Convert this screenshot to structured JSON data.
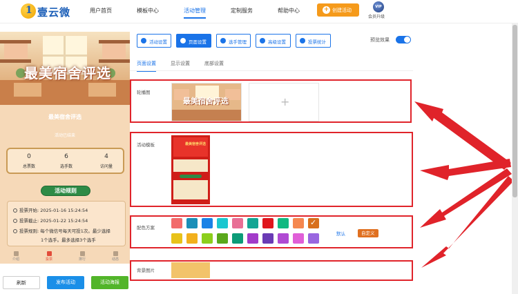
{
  "header": {
    "logo_text": "壹云微",
    "nav": [
      "用户首页",
      "模板中心",
      "活动管理",
      "定制服务",
      "帮助中心"
    ],
    "active_nav": 2,
    "create_label": "创建活动",
    "vip_badge": "VIP",
    "upgrade_label": "会员升级"
  },
  "preview": {
    "banner_title": "最美宿舍评选",
    "activity_title": "最美宿舍评选",
    "activity_subtitle": "活动已结束",
    "stats": [
      {
        "value": "0",
        "label": "总票数"
      },
      {
        "value": "6",
        "label": "选手数"
      },
      {
        "value": "4",
        "label": "访问量"
      }
    ],
    "rules_button": "活动规则",
    "rules": [
      "投票开始:  2025-01-16 15:24:54",
      "投票截止:  2025-01-22 15:24:54",
      "投票规则:  每个微信号每天可投1次。最少选择",
      "1个选手。最多选择3个选手"
    ],
    "tabbar": [
      {
        "label": "介绍",
        "active": false
      },
      {
        "label": "投票",
        "active": true
      },
      {
        "label": "排行",
        "active": false
      },
      {
        "label": "动态",
        "active": false
      }
    ]
  },
  "bottom_buttons": {
    "refresh": "刷新",
    "publish": "发布活动",
    "poster": "活动海报"
  },
  "toolbar": {
    "buttons": [
      {
        "label": "活动设置",
        "icon": "gear-icon",
        "active": false
      },
      {
        "label": "页面设置",
        "icon": "gear-icon",
        "active": true
      },
      {
        "label": "选手管理",
        "icon": "users-icon",
        "active": false
      },
      {
        "label": "高级设置",
        "icon": "settings-icon",
        "active": false
      },
      {
        "label": "投票统计",
        "icon": "chart-icon",
        "active": false
      }
    ],
    "preview_label": "预览效果",
    "preview_on": true
  },
  "subtabs": [
    "页面设置",
    "显示设置",
    "底部设置"
  ],
  "active_subtab": 0,
  "form": {
    "carousel_label": "轮播图",
    "carousel_image_text": "最美宿舍评选",
    "add_symbol": "+",
    "template_label": "活动模板",
    "template_title": "最美宿舍评选",
    "color_label": "配色方案",
    "colors_row1": [
      "#f26b6b",
      "#1a8fb8",
      "#1a82e6",
      "#1bc7d0",
      "#e86f95",
      "#13a594",
      "#e0161d",
      "#12b981",
      "#f5874f",
      "#d8701d"
    ],
    "colors_row2": [
      "#e8c21a",
      "#f2b01d",
      "#8ccf1c",
      "#5aa81c",
      "#0d9c78",
      "#a23bc9",
      "#6a3bb5",
      "#b04ad3",
      "#e05fd8",
      "#9966e0"
    ],
    "selected_color": 9,
    "default_link": "默认",
    "custom_button": "自定义",
    "bg_label": "背景图片",
    "bg_color": "#f2c36a"
  }
}
